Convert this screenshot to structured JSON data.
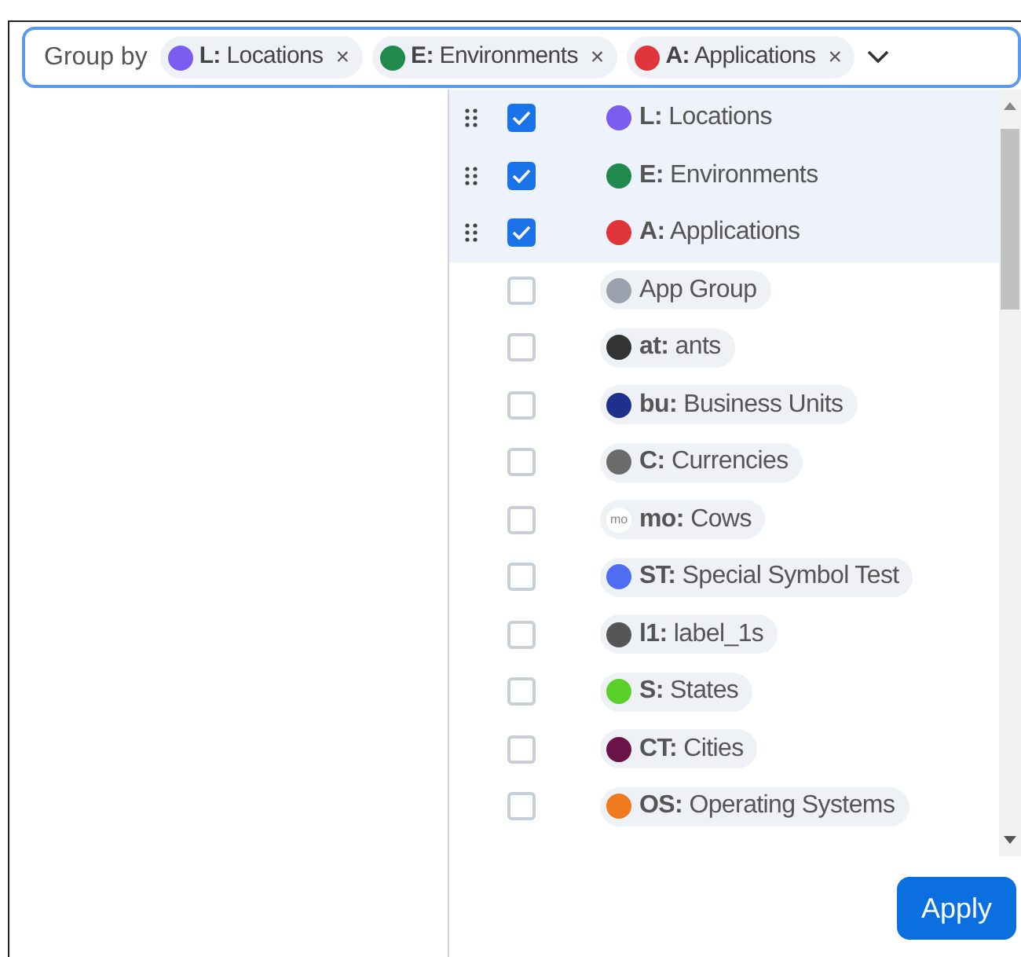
{
  "group_by": {
    "label": "Group by",
    "chips": [
      {
        "label": "**L:** Locations",
        "color": "#7b5cf0",
        "remove": "×"
      },
      {
        "label": "**E:** Environments",
        "color": "#1f8a4c",
        "remove": "×"
      },
      {
        "label": "**A:** Applications",
        "color": "#e0353b",
        "remove": "×"
      }
    ]
  },
  "options": [
    {
      "label": "**L:** Locations",
      "color": "#7b5cf0",
      "checked": true
    },
    {
      "label": "**E:** Environments",
      "color": "#1f8a4c",
      "checked": true
    },
    {
      "label": "**A:** Applications",
      "color": "#e0353b",
      "checked": true
    },
    {
      "label": "App Group",
      "color": "#9aa3ad",
      "checked": false
    },
    {
      "label": "**at:** ants",
      "color": "#333333",
      "checked": false
    },
    {
      "label": "**bu:** Business Units",
      "color": "#1e2f8c",
      "checked": false
    },
    {
      "label": "**C:** Currencies",
      "color": "#6b6b6b",
      "checked": false
    },
    {
      "label": "**mo:** Cows",
      "color": "#ffffff",
      "icon_text": "mo",
      "checked": false
    },
    {
      "label": "**ST:** Special Symbol Test",
      "color": "#4f6df0",
      "checked": false
    },
    {
      "label": "**l1:** label_1s",
      "color": "#555555",
      "checked": false
    },
    {
      "label": "**S:** States",
      "color": "#5ad12a",
      "checked": false
    },
    {
      "label": "**CT:** Cities",
      "color": "#6b1248",
      "checked": false
    },
    {
      "label": "**OS:** Operating Systems",
      "color": "#f07a1e",
      "checked": false
    }
  ],
  "apply_button": "Apply"
}
